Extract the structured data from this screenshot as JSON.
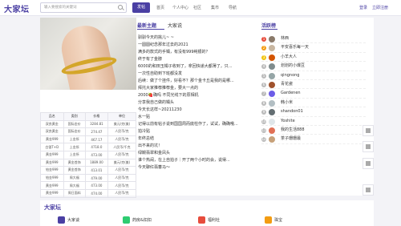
{
  "header": {
    "logo": "大家坛",
    "search_placeholder": "输入要搜索的关键词",
    "post_button": "发帖",
    "nav": [
      "首页",
      "个人中心",
      "社区",
      "集市",
      "导航"
    ],
    "login": "登录",
    "register": "立即注册"
  },
  "table": {
    "headers": [
      "品名",
      "类别",
      "价格",
      "单位"
    ],
    "rows": [
      [
        "双良黄金",
        "国际金价",
        "3284.81",
        "美元/克(美)"
      ],
      [
        "双良黄金",
        "国际金价",
        "274.47",
        "人民币/克"
      ],
      [
        "黄金999",
        "上金所",
        "467.17",
        "人民币/克"
      ],
      [
        "白银T+D",
        "上金所",
        "4718.0",
        "人民币/千克"
      ],
      [
        "黄金999",
        "上金所",
        "473.00",
        "人民币/克"
      ],
      [
        "黄金999",
        "黄金首饰",
        "1889.00",
        "美元/克(美)"
      ],
      [
        "铂金999",
        "黄金首饰",
        "413.01",
        "人民币/克"
      ],
      [
        "铂金999",
        "周大福",
        "479.00",
        "人民币/克"
      ],
      [
        "黄金999",
        "周大福",
        "473.00",
        "人民币/克"
      ],
      [
        "黄金999",
        "周日面料",
        "474.00",
        "人民币/克"
      ]
    ]
  },
  "tabs": [
    "最新主题",
    "大家说"
  ],
  "topics": [
    "驯驯今天的挑儿~ ~",
    "一圆圆纪念那年过去的2021",
    "满多的款式的手镯，有没有999纯银的？",
    "终于有了金脖",
    "6000的和田玉镯子收到了，拿回快递大都薄了，只...",
    "一次性自助到下班都没发",
    "后续：做了个挂件，好看不？那个金卡丘是我的是哪...",
    "拜托大家推荐推荐金，要大一点的",
    "2000🍓确吗 不同光线下的原相机",
    "分享我自己做的镯头",
    "今天长这样~20211230",
    "水一贴",
    "记得以前有帖子说到国国周而底柱作了，试试，确确哦...",
    "拍冷贴",
    "年终总结",
    "出不来的坑！",
    "绿鳗翡翠和金凤头",
    "谁个热闹，在上自拍子｜开了两个小时的会，说得...",
    "今天聊红翡蕃马～"
  ],
  "hot": {
    "title": "活跃榜",
    "users": [
      "林西",
      "平安喜乐每一天",
      "小羊大人",
      "划划的小爆豆",
      "qingnong",
      "青花瓷",
      "Gardenen",
      "韩小米",
      "shandon01",
      "Yoshite",
      "我的生活888",
      "茶子珊珊最"
    ]
  },
  "bottom": {
    "title": "大家坛",
    "categories": [
      "大家谈",
      "药房&扣扣",
      "福利社",
      "珠宝"
    ]
  }
}
